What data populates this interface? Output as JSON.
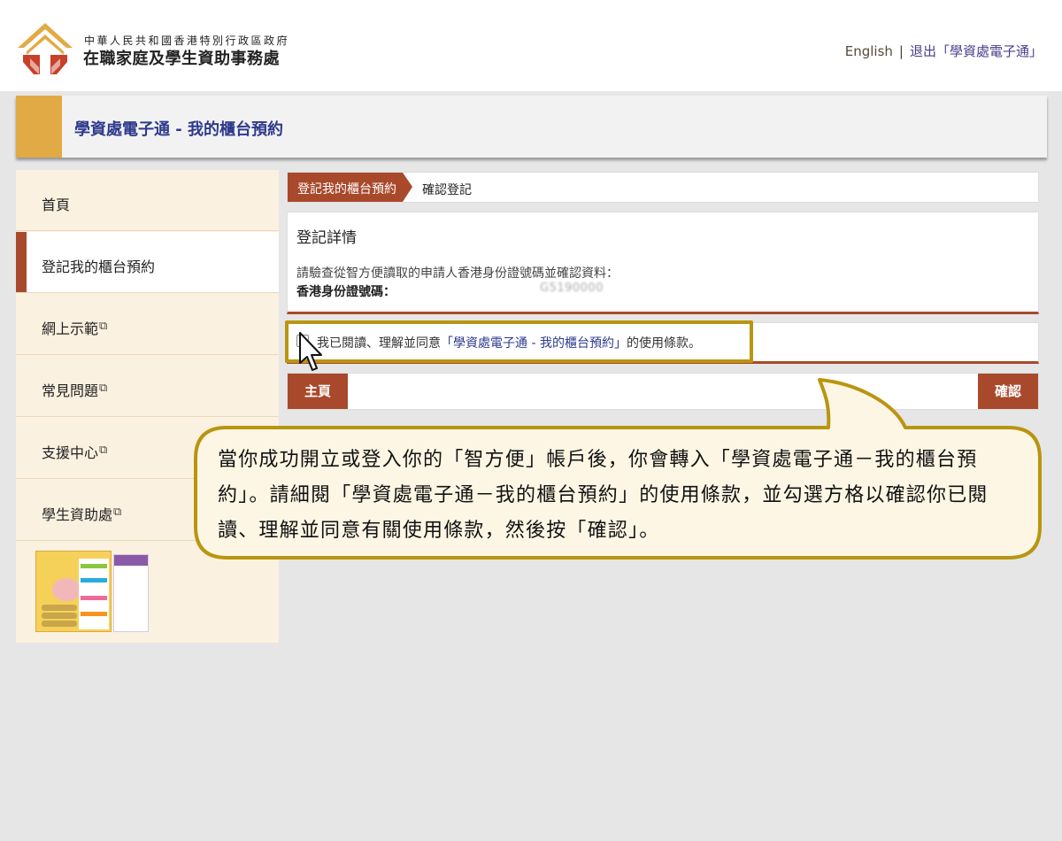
{
  "header": {
    "org_line1": "中華人民共和國香港特別行政區政府",
    "org_line2": "在職家庭及學生資助事務處",
    "english_link": "English",
    "separator": "|",
    "logout_link": "退出「學資處電子通」"
  },
  "page_title": "學資處電子通 - 我的櫃台預約",
  "sidebar": {
    "items": [
      {
        "label": "首頁",
        "external": false
      },
      {
        "label": "登記我的櫃台預約",
        "external": false,
        "active": true
      },
      {
        "label": "網上示範",
        "external": true
      },
      {
        "label": "常見問題",
        "external": true
      },
      {
        "label": "支援中心",
        "external": true
      },
      {
        "label": "學生資助處",
        "external": true
      }
    ],
    "external_icon": "external-link-icon"
  },
  "breadcrumb": {
    "step1": "登記我的櫃台預約",
    "step2": "確認登記"
  },
  "details": {
    "heading": "登記詳情",
    "instruction": "請驗查從智方便讀取的申請人香港身份證號碼並確認資料：",
    "id_label": "香港身份證號碼：",
    "id_value": "G5190000"
  },
  "agreement": {
    "checked": false,
    "prefix": "我已閱讀、理解並同意",
    "terms_link": "「學資處電子通 - 我的櫃台預約」",
    "suffix": "的使用條款。"
  },
  "buttons": {
    "home": "主頁",
    "confirm": "確認"
  },
  "callout": {
    "text": "當你成功開立或登入你的「智方便」帳戶後，你會轉入「學資處電子通－我的櫃台預約」。請細閱「學資處電子通－我的櫃台預約」的使用條款，並勾選方格以確認你已閱讀、理解並同意有關使用條款，然後按「確認」。"
  },
  "colors": {
    "brand_brown": "#a9492b",
    "accent_gold": "#e2aa45",
    "highlight_gold": "#b99510",
    "title_blue": "#2d3a8c",
    "callout_bg": "#fdf6e4"
  }
}
